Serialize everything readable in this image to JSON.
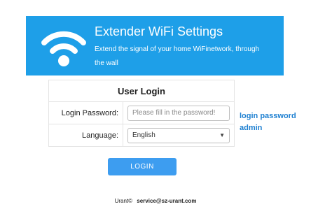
{
  "header": {
    "icon": "wifi-icon",
    "title": "Extender WiFi Settings",
    "subtitle": "Extend the signal of your home WiFinetwork, through the wall",
    "background_color": "#1e9fe8"
  },
  "login": {
    "heading": "User Login",
    "password_label": "Login Password:",
    "password_placeholder": "Please fill in the password!",
    "password_value": "",
    "language_label": "Language:",
    "language_selected": "English",
    "button_label": "LOGIN",
    "button_color": "#3d9df0"
  },
  "side_note": {
    "line1": "login password",
    "line2": "admin",
    "color": "#1c7fd1"
  },
  "footer": {
    "brand": "Urant©",
    "email": "service@sz-urant.com"
  }
}
